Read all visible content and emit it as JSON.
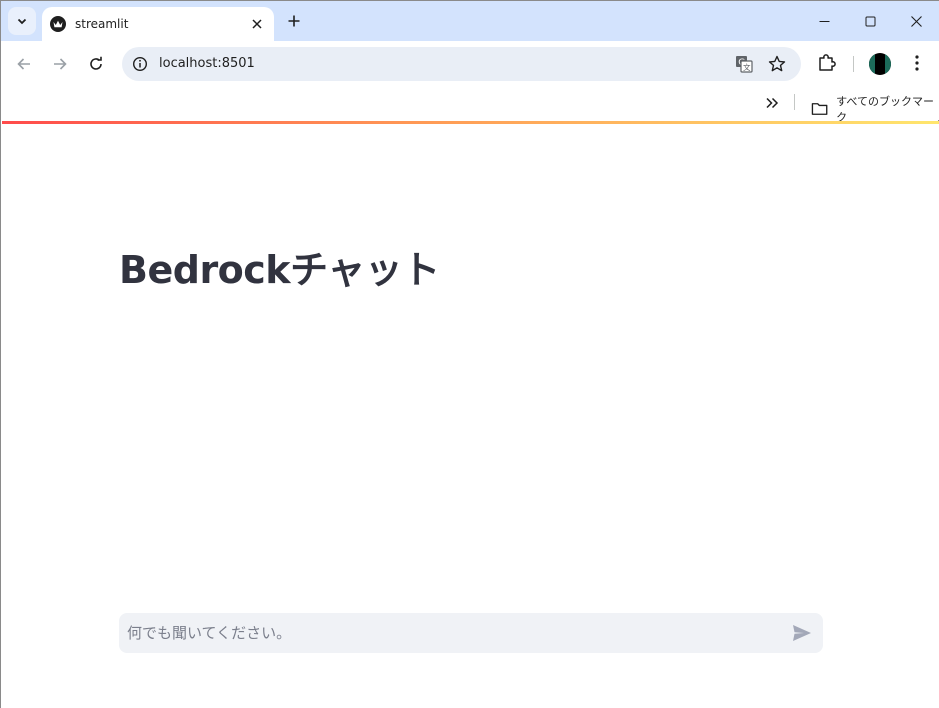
{
  "browser": {
    "tab": {
      "title": "streamlit"
    },
    "address": {
      "url": "localhost:8501"
    },
    "bookmarks": {
      "all_bookmarks_label": "すべてのブックマーク"
    }
  },
  "page": {
    "title": "Bedrockチャット",
    "chat": {
      "placeholder": "何でも聞いてください。"
    }
  },
  "colors": {
    "tabstrip": "#d3e3fd",
    "omnibox": "#e9eef6",
    "title_text": "#31333f",
    "chat_bg": "#f0f2f6",
    "accent_gradient": [
      "#ff4b4b",
      "#ffe66d"
    ]
  },
  "icons": {
    "tab_search": "chevron-down-icon",
    "favicon": "crown-icon",
    "tab_close": "close-icon",
    "new_tab": "plus-icon",
    "minimize": "minimize-icon",
    "maximize": "maximize-icon",
    "close": "close-icon",
    "back": "arrow-left-icon",
    "forward": "arrow-right-icon",
    "reload": "reload-icon",
    "site_info": "info-icon",
    "translate": "translate-icon",
    "bookmark": "star-icon",
    "extensions": "puzzle-icon",
    "menu": "kebab-icon",
    "bookmarks_more": "double-chevron-icon",
    "folder": "folder-icon",
    "send": "send-icon"
  }
}
